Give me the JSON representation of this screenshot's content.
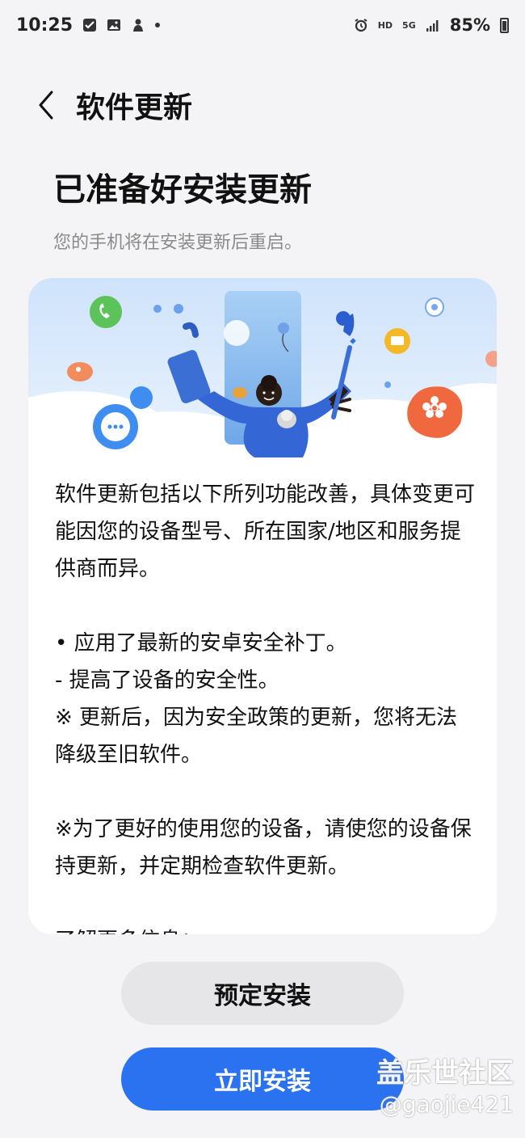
{
  "status_bar": {
    "time": "10:25",
    "hd": "HD",
    "network": "5G",
    "battery": "85%"
  },
  "header": {
    "back_icon": "chevron-left-icon",
    "title": "软件更新"
  },
  "main": {
    "heading": "已准备好安装更新",
    "subheading": "您的手机将在安装更新后重启。"
  },
  "card": {
    "intro": "软件更新包括以下所列功能改善，具体变更可能因您的设备型号、所在国家/地区和服务提供商而异。",
    "bullet1": "• 应用了最新的安卓安全补丁。",
    "bullet1_sub": " - 提高了设备的安全性。",
    "note1": "※ 更新后，因为安全政策的更新，您将无法降级至旧软件。",
    "note2": "※为了更好的使用您的设备，请使您的设备保持更新，并定期检查软件更新。",
    "more_info": "了解更多信息："
  },
  "buttons": {
    "schedule_label": "预定安装",
    "install_label": "立即安装"
  },
  "watermark": {
    "site": "盖乐世社区",
    "user": "@gaojie421"
  },
  "colors": {
    "background": "#f4f4f6",
    "card": "#ffffff",
    "primary_button": "#2a72f0",
    "secondary_button": "#e6e6e8"
  }
}
